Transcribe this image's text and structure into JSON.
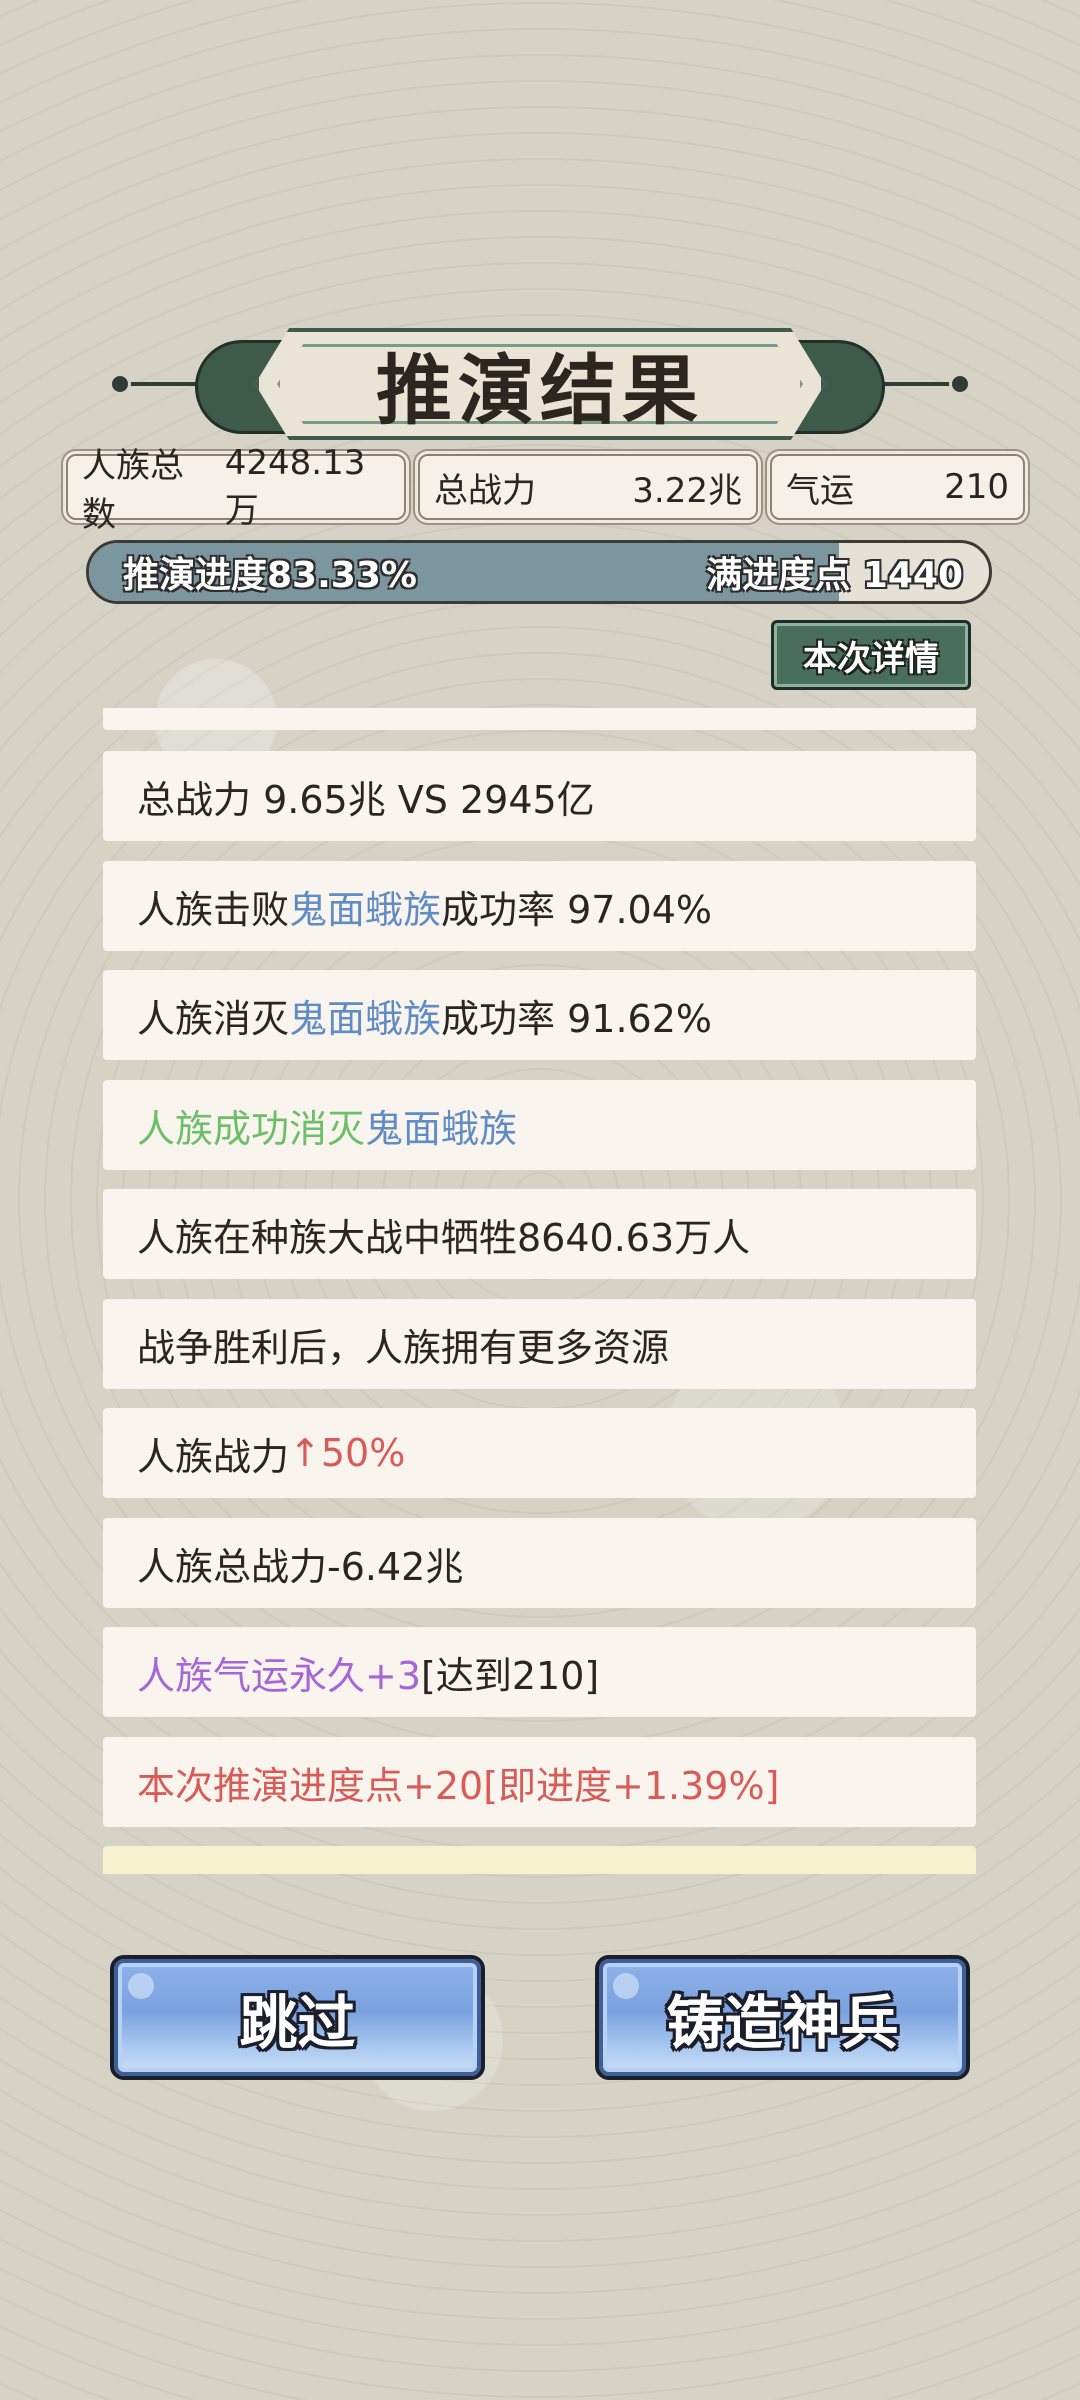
{
  "banner": {
    "title": "推演结果"
  },
  "stats": {
    "population_label": "人族总数",
    "population_value": "4248.13万",
    "power_label": "总战力",
    "power_value": "3.22兆",
    "luck_label": "气运",
    "luck_value": "210"
  },
  "progress": {
    "label": "推演进度83.33%",
    "value_percent": 83.33,
    "max_label": "满进度点 1440"
  },
  "detail_button": "本次详情",
  "results": [
    {
      "segments": [
        {
          "text": "总战力 9.65兆 VS 2945亿",
          "color": "default"
        }
      ]
    },
    {
      "segments": [
        {
          "text": "人族击败",
          "color": "default"
        },
        {
          "text": "鬼面蛾族",
          "color": "blue"
        },
        {
          "text": "成功率 97.04%",
          "color": "default"
        }
      ]
    },
    {
      "segments": [
        {
          "text": "人族消灭",
          "color": "default"
        },
        {
          "text": "鬼面蛾族",
          "color": "blue"
        },
        {
          "text": "成功率 91.62%",
          "color": "default"
        }
      ]
    },
    {
      "segments": [
        {
          "text": "人族成功消灭",
          "color": "green"
        },
        {
          "text": "鬼面蛾族",
          "color": "blue"
        }
      ]
    },
    {
      "segments": [
        {
          "text": "人族在种族大战中牺牲8640.63万人",
          "color": "default"
        }
      ]
    },
    {
      "segments": [
        {
          "text": "战争胜利后，人族拥有更多资源",
          "color": "default"
        }
      ]
    },
    {
      "segments": [
        {
          "text": "人族战力",
          "color": "default"
        },
        {
          "text": "↑50%",
          "color": "red"
        }
      ]
    },
    {
      "segments": [
        {
          "text": "人族总战力-6.42兆",
          "color": "default"
        }
      ]
    },
    {
      "segments": [
        {
          "text": "人族气运永久+3",
          "color": "purple"
        },
        {
          "text": "[达到210]",
          "color": "default"
        }
      ]
    },
    {
      "segments": [
        {
          "text": "本次推演进度点+20[即进度+1.39%]",
          "color": "red"
        }
      ]
    }
  ],
  "colors": {
    "default": "#2a2520",
    "blue": "#5f8cc4",
    "green": "#6cbf68",
    "red": "#d85b56",
    "purple": "#a566d6",
    "progress_fill": "#7c96a0",
    "banner_green": "#3d5a4b"
  },
  "buttons": {
    "skip": "跳过",
    "forge": "铸造神兵"
  }
}
